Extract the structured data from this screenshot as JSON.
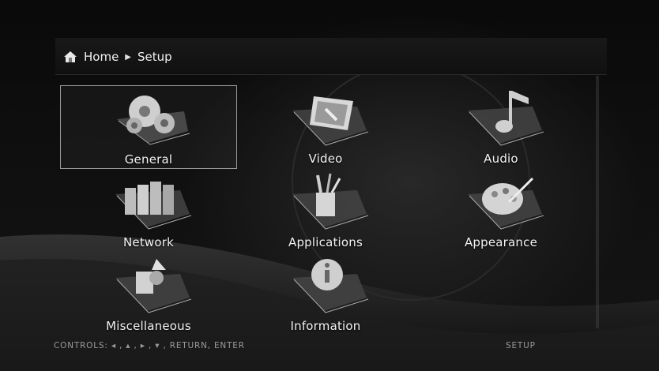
{
  "breadcrumb": {
    "home_icon": "home-icon",
    "home": "Home",
    "separator_icon": "triangle-right-icon",
    "current": "Setup"
  },
  "menu": {
    "selected": "General",
    "items": [
      {
        "label": "General",
        "icon": "gears-icon"
      },
      {
        "label": "Video",
        "icon": "video-screen-icon"
      },
      {
        "label": "Audio",
        "icon": "music-note-icon"
      },
      {
        "label": "Network",
        "icon": "network-servers-icon"
      },
      {
        "label": "Applications",
        "icon": "tools-cup-icon"
      },
      {
        "label": "Appearance",
        "icon": "paint-palette-icon"
      },
      {
        "label": "Miscellaneous",
        "icon": "misc-shapes-icon"
      },
      {
        "label": "Information",
        "icon": "info-icon"
      }
    ]
  },
  "footer": {
    "controls": "CONTROLS:  ◂ ,  ▴ ,  ▸ ,  ▾ ,  RETURN,  ENTER",
    "setup": "SETUP"
  },
  "colors": {
    "background": "#000000",
    "text": "#f4f4f4",
    "footer_text": "#9a9a9a",
    "selection_border": "#9a9a9a"
  }
}
